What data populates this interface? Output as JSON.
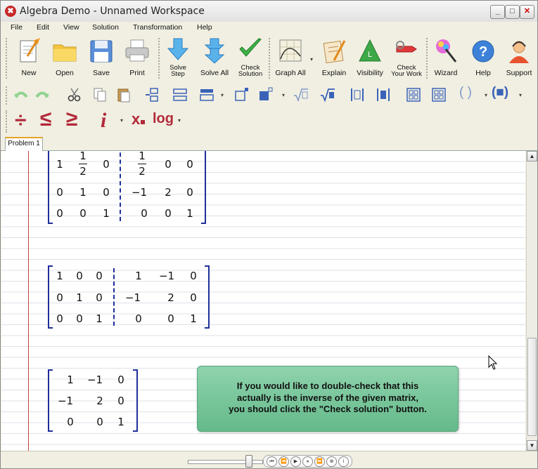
{
  "window": {
    "title": "Algebra Demo - Unnamed Workspace",
    "controls": [
      "_",
      "□",
      "✕"
    ]
  },
  "menu": [
    "File",
    "Edit",
    "View",
    "Solution",
    "Transformation",
    "Help"
  ],
  "toolbar": {
    "new": "New",
    "open": "Open",
    "save": "Save",
    "print": "Print",
    "solve_step_1": "Solve",
    "solve_step_2": "Step",
    "solve_all": "Solve All",
    "check_solution_1": "Check",
    "check_solution_2": "Solution",
    "graph_all": "Graph All",
    "explain": "Explain",
    "visibility": "Visibility",
    "check_work_1": "Check",
    "check_work_2": "Your Work",
    "wizard": "Wizard",
    "help": "Help",
    "support": "Support"
  },
  "symbols": {
    "divide": "÷",
    "le": "≤",
    "ge": "≥",
    "imag": "i",
    "sub": "x",
    "log": "log",
    "parens": "( )",
    "bracket_box": "(■)"
  },
  "tabs": [
    "Problem 1"
  ],
  "matrix1": {
    "left": [
      [
        "1",
        "½",
        "0"
      ],
      [
        "0",
        "1",
        "0"
      ],
      [
        "0",
        "0",
        "1"
      ]
    ],
    "right": [
      [
        "½",
        "0",
        "0"
      ],
      [
        "−1",
        "2",
        "0"
      ],
      [
        "0",
        "0",
        "1"
      ]
    ],
    "frac_num": "1",
    "frac_den": "2"
  },
  "matrix2": {
    "left": [
      [
        "1",
        "0",
        "0"
      ],
      [
        "0",
        "1",
        "0"
      ],
      [
        "0",
        "0",
        "1"
      ]
    ],
    "right": [
      [
        "1",
        "−1",
        "0"
      ],
      [
        "−1",
        "2",
        "0"
      ],
      [
        "0",
        "0",
        "1"
      ]
    ]
  },
  "matrix3": {
    "rows": [
      [
        "1",
        "−1",
        "0"
      ],
      [
        "−1",
        "2",
        "0"
      ],
      [
        "0",
        "0",
        "1"
      ]
    ]
  },
  "callout": {
    "line1": "If you would like to double-check that this",
    "line2": "actually is the inverse of the given matrix,",
    "line3": "you should click the \"Check solution\" button."
  },
  "playback": [
    "⏮",
    "⏪",
    "▶",
    "⏸",
    "⏩",
    "⊗",
    "i"
  ]
}
